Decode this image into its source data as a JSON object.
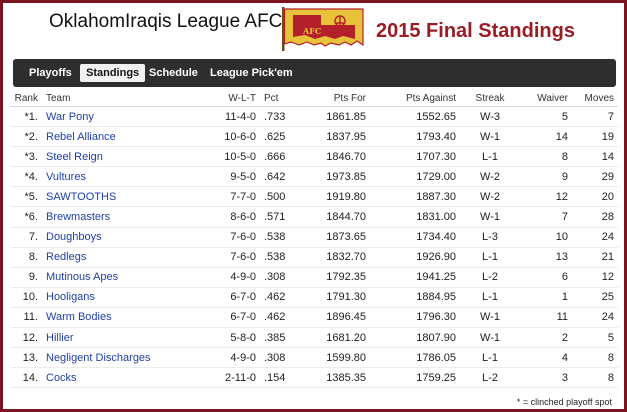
{
  "header": {
    "league_title": "OklahomIraqis League AFC",
    "season_title": "2015 Final Standings",
    "logo": {
      "text": "AFC",
      "flag_color": "#e8c23a",
      "accent": "#b3202a"
    }
  },
  "nav": {
    "tabs": [
      {
        "label": "Playoffs",
        "active": false
      },
      {
        "label": "Standings",
        "active": true
      },
      {
        "label": "Schedule",
        "active": false
      },
      {
        "label": "League Pick'em",
        "active": false
      }
    ]
  },
  "table": {
    "headers": {
      "rank": "Rank",
      "team": "Team",
      "wlt": "W-L-T",
      "pct": "Pct",
      "pts_for": "Pts For",
      "pts_against": "Pts Against",
      "streak": "Streak",
      "waiver": "Waiver",
      "moves": "Moves"
    },
    "rows": [
      {
        "rank": "*1.",
        "team": "War Pony",
        "wlt": "11-4-0",
        "pct": ".733",
        "pts_for": "1861.85",
        "pts_against": "1552.65",
        "streak": "W-3",
        "waiver": "5",
        "moves": "7"
      },
      {
        "rank": "*2.",
        "team": "Rebel Alliance",
        "wlt": "10-6-0",
        "pct": ".625",
        "pts_for": "1837.95",
        "pts_against": "1793.40",
        "streak": "W-1",
        "waiver": "14",
        "moves": "19"
      },
      {
        "rank": "*3.",
        "team": "Steel Reign",
        "wlt": "10-5-0",
        "pct": ".666",
        "pts_for": "1846.70",
        "pts_against": "1707.30",
        "streak": "L-1",
        "waiver": "8",
        "moves": "14"
      },
      {
        "rank": "*4.",
        "team": "Vultures",
        "wlt": "9-5-0",
        "pct": ".642",
        "pts_for": "1973.85",
        "pts_against": "1729.00",
        "streak": "W-2",
        "waiver": "9",
        "moves": "29"
      },
      {
        "rank": "*5.",
        "team": "SAWTOOTHS",
        "wlt": "7-7-0",
        "pct": ".500",
        "pts_for": "1919.80",
        "pts_against": "1887.30",
        "streak": "W-2",
        "waiver": "12",
        "moves": "20"
      },
      {
        "rank": "*6.",
        "team": "Brewmasters",
        "wlt": "8-6-0",
        "pct": ".571",
        "pts_for": "1844.70",
        "pts_against": "1831.00",
        "streak": "W-1",
        "waiver": "7",
        "moves": "28"
      },
      {
        "rank": "7.",
        "team": "Doughboys",
        "wlt": "7-6-0",
        "pct": ".538",
        "pts_for": "1873.65",
        "pts_against": "1734.40",
        "streak": "L-3",
        "waiver": "10",
        "moves": "24"
      },
      {
        "rank": "8.",
        "team": "Redlegs",
        "wlt": "7-6-0",
        "pct": ".538",
        "pts_for": "1832.70",
        "pts_against": "1926.90",
        "streak": "L-1",
        "waiver": "13",
        "moves": "21"
      },
      {
        "rank": "9.",
        "team": "Mutinous Apes",
        "wlt": "4-9-0",
        "pct": ".308",
        "pts_for": "1792.35",
        "pts_against": "1941.25",
        "streak": "L-2",
        "waiver": "6",
        "moves": "12"
      },
      {
        "rank": "10.",
        "team": "Hooligans",
        "wlt": "6-7-0",
        "pct": ".462",
        "pts_for": "1791.30",
        "pts_against": "1884.95",
        "streak": "L-1",
        "waiver": "1",
        "moves": "25"
      },
      {
        "rank": "11.",
        "team": "Warm Bodies",
        "wlt": "6-7-0",
        "pct": ".462",
        "pts_for": "1896.45",
        "pts_against": "1796.30",
        "streak": "W-1",
        "waiver": "11",
        "moves": "24"
      },
      {
        "rank": "12.",
        "team": "Hillier",
        "wlt": "5-8-0",
        "pct": ".385",
        "pts_for": "1681.20",
        "pts_against": "1807.90",
        "streak": "W-1",
        "waiver": "2",
        "moves": "5"
      },
      {
        "rank": "13.",
        "team": "Negligent Discharges",
        "wlt": "4-9-0",
        "pct": ".308",
        "pts_for": "1599.80",
        "pts_against": "1786.05",
        "streak": "L-1",
        "waiver": "4",
        "moves": "8"
      },
      {
        "rank": "14.",
        "team": "Cocks",
        "wlt": "2-11-0",
        "pct": ".154",
        "pts_for": "1385.35",
        "pts_against": "1759.25",
        "streak": "L-2",
        "waiver": "3",
        "moves": "8"
      }
    ]
  },
  "footnote": "* = clinched playoff spot"
}
